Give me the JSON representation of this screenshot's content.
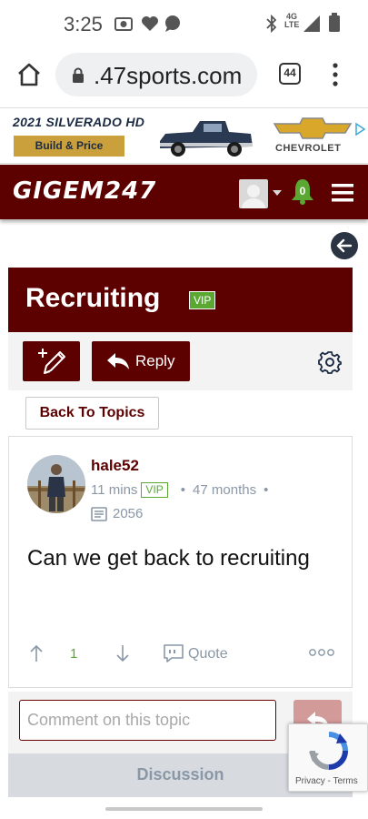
{
  "status_bar": {
    "time": "3:25",
    "network": "4G LTE"
  },
  "browser": {
    "url": ".47sports.com",
    "tab_count": "44"
  },
  "ad": {
    "headline": "2021 SILVERADO HD",
    "cta": "Build & Price",
    "brand": "CHEVROLET"
  },
  "site": {
    "logo": "GIGEM247",
    "notification_count": "0"
  },
  "board": {
    "title": "Recruiting",
    "badge": "VIP",
    "reply_label": "Reply",
    "back_to_topics": "Back To Topics"
  },
  "post": {
    "author": "hale52",
    "time_ago": "11 mins",
    "badge": "VIP",
    "member_for": "47 months",
    "post_count": "2056",
    "body": "Can we get back to recruiting",
    "upvotes": "1",
    "quote_label": "Quote"
  },
  "comment": {
    "placeholder": "Comment on this topic"
  },
  "discussion_tab": "Discussion",
  "recaptcha": {
    "links": "Privacy - Terms"
  },
  "colors": {
    "maroon": "#5c0000",
    "vip_green": "#5aa832",
    "muted_text": "#8a97a6"
  }
}
